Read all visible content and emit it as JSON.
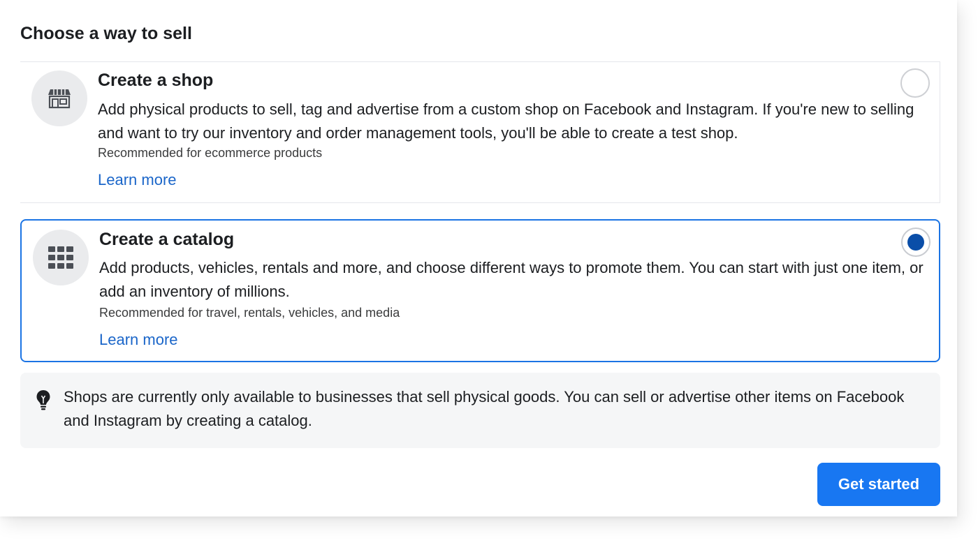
{
  "dialog": {
    "title": "Choose a way to sell"
  },
  "options": [
    {
      "icon": "storefront-icon",
      "title": "Create a shop",
      "description": "Add physical products to sell, tag and advertise from a custom shop on Facebook and Instagram. If you're new to selling and want to try our inventory and order management tools, you'll be able to create a test shop.",
      "recommendation": "Recommended for ecommerce products",
      "link": "Learn more",
      "selected": false
    },
    {
      "icon": "grid-icon",
      "title": "Create a catalog",
      "description": "Add products, vehicles, rentals and more, and choose different ways to promote them. You can start with just one item, or add an inventory of millions.",
      "recommendation": "Recommended for travel, rentals, vehicles, and media",
      "link": "Learn more",
      "selected": true
    }
  ],
  "notice": {
    "icon": "lightbulb-icon",
    "text": "Shops are currently only available to businesses that sell physical goods. You can sell or advertise other items on Facebook and Instagram by creating a catalog."
  },
  "footer": {
    "primary_button": "Get started"
  },
  "colors": {
    "accent": "#1877f2",
    "link": "#1b66c9",
    "selected_border": "#1b74e4",
    "radio_fill": "#0a4ea8"
  }
}
